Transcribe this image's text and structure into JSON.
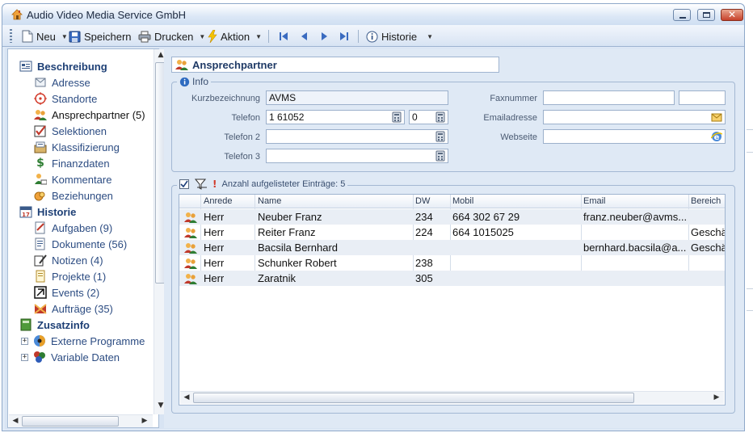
{
  "window": {
    "title": "Audio Video Media Service GmbH",
    "accent": "#dbe7f6",
    "close_color": "#c6402a"
  },
  "toolbar": {
    "new_label": "Neu",
    "save_label": "Speichern",
    "print_label": "Drucken",
    "action_label": "Aktion",
    "history_label": "Historie"
  },
  "sidebar": {
    "groups": [
      {
        "label": "Beschreibung",
        "icon": "description-icon"
      },
      {
        "label": "Historie",
        "icon": "calendar-icon"
      },
      {
        "label": "Zusatzinfo",
        "icon": "book-icon"
      }
    ],
    "description_items": [
      {
        "label": "Adresse",
        "icon": "address-icon"
      },
      {
        "label": "Standorte",
        "icon": "location-icon"
      },
      {
        "label": "Ansprechpartner (5)",
        "icon": "contacts-icon"
      },
      {
        "label": "Selektionen",
        "icon": "checkmark-icon"
      },
      {
        "label": "Klassifizierung",
        "icon": "classification-icon"
      },
      {
        "label": "Finanzdaten",
        "icon": "dollar-icon"
      },
      {
        "label": "Kommentare",
        "icon": "comment-icon"
      },
      {
        "label": "Beziehungen",
        "icon": "relations-icon"
      }
    ],
    "history_items": [
      {
        "label": "Aufgaben (9)",
        "icon": "task-icon"
      },
      {
        "label": "Dokumente (56)",
        "icon": "document-icon"
      },
      {
        "label": "Notizen (4)",
        "icon": "note-icon"
      },
      {
        "label": "Projekte (1)",
        "icon": "project-icon"
      },
      {
        "label": "Events (2)",
        "icon": "event-icon"
      },
      {
        "label": "Aufträge (35)",
        "icon": "order-icon"
      }
    ],
    "extra_items": [
      {
        "label": "Externe Programme",
        "icon": "external-programs-icon"
      },
      {
        "label": "Variable Daten",
        "icon": "variable-data-icon"
      }
    ]
  },
  "section": {
    "title": "Ansprechpartner"
  },
  "info": {
    "legend": "Info",
    "short_name_label": "Kurzbezeichnung",
    "short_name_value": "AVMS",
    "phone_label": "Telefon",
    "phone_value": "1 61052",
    "phone_ext_value": "0",
    "phone2_label": "Telefon 2",
    "phone2_value": "",
    "phone3_label": "Telefon 3",
    "phone3_value": "",
    "fax_label": "Faxnummer",
    "fax_value": "",
    "email_label": "Emailadresse",
    "email_value": "",
    "website_label": "Webseite",
    "website_value": ""
  },
  "list": {
    "count_label": "Anzahl aufgelisteter Einträge: 5",
    "columns": [
      "Anrede",
      "Name",
      "DW",
      "Mobil",
      "Email",
      "Bereich"
    ],
    "rows": [
      {
        "anrede": "Herr",
        "name": "Neuber Franz",
        "dw": "234",
        "mobil": "664 302 67 29",
        "email": "franz.neuber@avms...",
        "bereich": ""
      },
      {
        "anrede": "Herr",
        "name": "Reiter Franz",
        "dw": "224",
        "mobil": "664 1015025",
        "email": "",
        "bereich": "Geschä"
      },
      {
        "anrede": "Herr",
        "name": "Bacsila Bernhard",
        "dw": "",
        "mobil": "",
        "email": "bernhard.bacsila@a...",
        "bereich": "Geschä"
      },
      {
        "anrede": "Herr",
        "name": "Schunker Robert",
        "dw": "238",
        "mobil": "",
        "email": "",
        "bereich": ""
      },
      {
        "anrede": "Herr",
        "name": "Zaratnik",
        "dw": "305",
        "mobil": "",
        "email": "",
        "bereich": ""
      }
    ]
  }
}
